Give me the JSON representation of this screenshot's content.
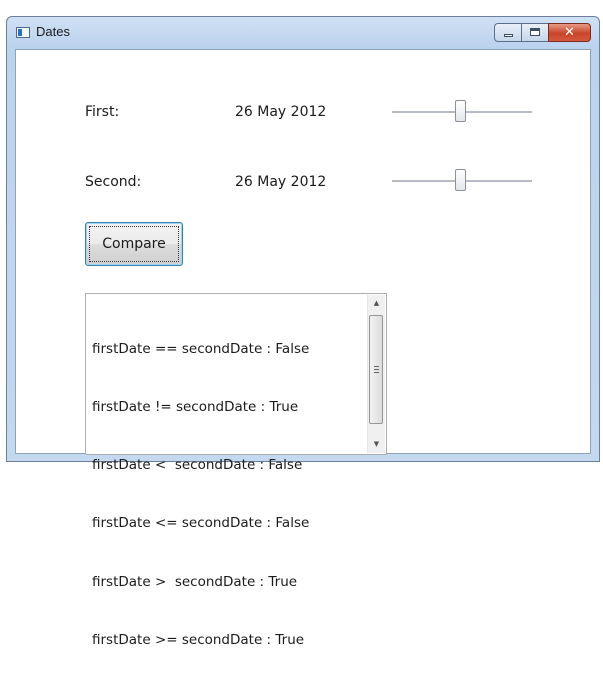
{
  "window": {
    "title": "Dates",
    "close_glyph": "✕"
  },
  "form": {
    "first_label": "First:",
    "first_value": "26 May 2012",
    "first_slider_value": 0.49,
    "second_label": "Second:",
    "second_value": "26 May 2012",
    "second_slider_value": 0.49,
    "compare_label": "Compare"
  },
  "results": {
    "lines": [
      "firstDate == secondDate : False",
      "firstDate != secondDate : True",
      "firstDate <  secondDate : False",
      "firstDate <= secondDate : False",
      "firstDate >  secondDate : True",
      "firstDate >= secondDate : True"
    ],
    "up_arrow": "▲",
    "down_arrow": "▼"
  },
  "icons": [
    "app-icon",
    "minimize-icon",
    "maximize-icon",
    "close-icon",
    "scroll-up-icon",
    "scroll-down-icon",
    "scroll-grip-icon"
  ]
}
